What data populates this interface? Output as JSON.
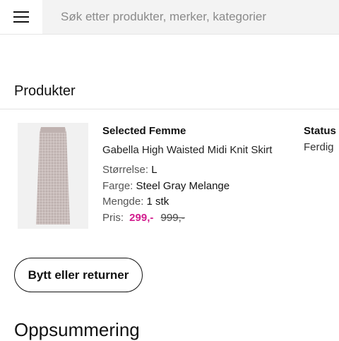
{
  "header": {
    "menu_icon": "hamburger-menu-icon",
    "search_placeholder": "Søk etter produkter, merker, kategorier"
  },
  "products_section": {
    "title": "Produkter",
    "status_header": "Status",
    "items": [
      {
        "brand": "Selected Femme",
        "name": "Gabella High Waisted Midi Knit Skirt",
        "size_label": "Størrelse:",
        "size_value": "L",
        "color_label": "Farge:",
        "color_value": "Steel Gray Melange",
        "qty_label": "Mengde:",
        "qty_value": "1 stk",
        "price_label": "Pris:",
        "price_sale": "299,-",
        "price_original": "999,-",
        "status": "Ferdig"
      }
    ]
  },
  "actions": {
    "return_button": "Bytt eller returner"
  },
  "summary": {
    "title": "Oppsummering"
  },
  "colors": {
    "sale_price": "#d21d8e",
    "search_bg": "#f3f3f3"
  }
}
